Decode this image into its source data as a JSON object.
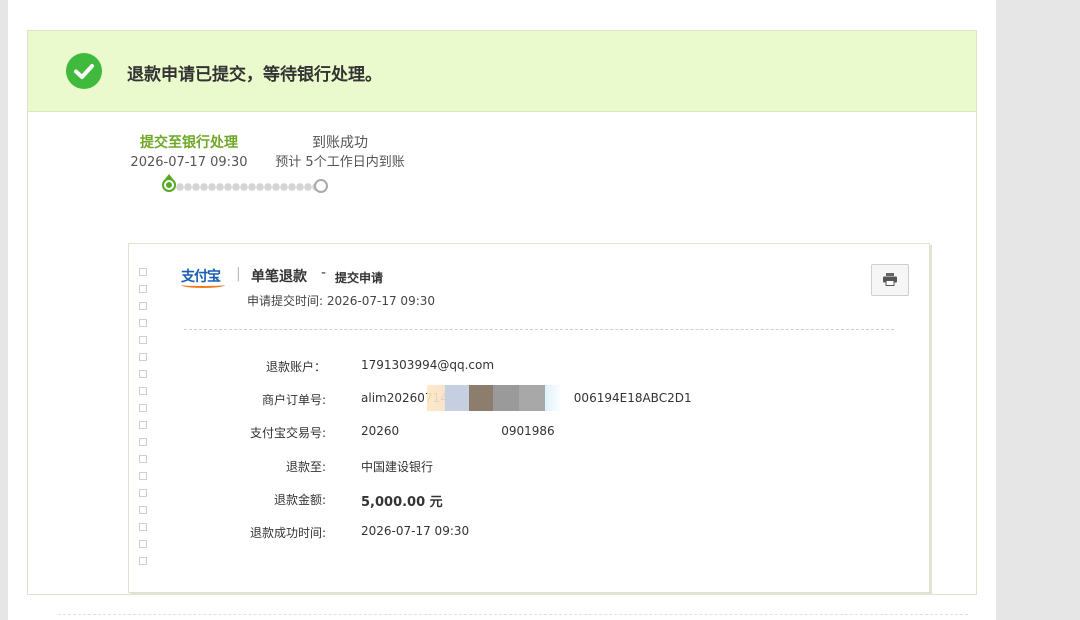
{
  "banner": {
    "message": "退款申请已提交，等待银行处理。"
  },
  "progress": {
    "steps": [
      {
        "title": "提交至银行处理",
        "sub": "2026-07-17 09:30",
        "state": "current"
      },
      {
        "title": "到账成功",
        "sub": "预计 5个工作日内到账",
        "state": "pending"
      }
    ]
  },
  "receipt": {
    "brand": "支付宝",
    "separator": "|",
    "title": "单笔退款",
    "dash": "-",
    "subtitle": "提交申请",
    "submit_time_label": "申请提交时间:",
    "submit_time_value": "2026-07-17 09:30",
    "rows": [
      {
        "label": "退款账户：",
        "value": "1791303994@qq.com"
      },
      {
        "label": "商户订单号:",
        "value": "alim20260714",
        "value_tail": "006194E18ABC2D1"
      },
      {
        "label": "支付宝交易号:",
        "value": "20260",
        "value_tail": "0901986"
      },
      {
        "label": "退款至:",
        "value": "中国建设银行"
      },
      {
        "label": "退款金额:",
        "value": "5,000.00 元"
      },
      {
        "label": "退款成功时间:",
        "value": "2026-07-17 09:30"
      }
    ]
  },
  "colors": {
    "banner_bg": "#ebfacc",
    "success_green": "#3fba3d",
    "step_active": "#6fa827"
  },
  "icons": {
    "banner": "check-circle-icon",
    "print": "printer-icon"
  }
}
